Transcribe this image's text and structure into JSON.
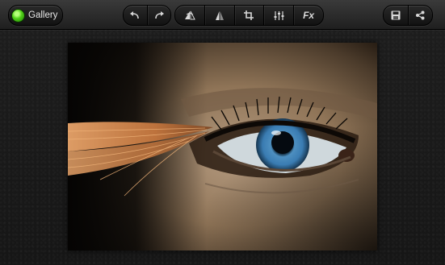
{
  "toolbar": {
    "gallery_label": "Gallery",
    "fx_label": "Fx"
  },
  "icons": {
    "gallery": "green-dot-icon",
    "undo": "undo-icon",
    "redo": "redo-icon",
    "straighten": "straighten-icon",
    "mirror": "mirror-flip-icon",
    "crop": "crop-icon",
    "adjust": "adjust-sliders-icon",
    "save": "save-disk-icon",
    "share": "share-icon"
  },
  "colors": {
    "toolbar_bg": "#2a2a2a",
    "accent_green": "#4fcf17",
    "icon": "#d8d8d8"
  }
}
